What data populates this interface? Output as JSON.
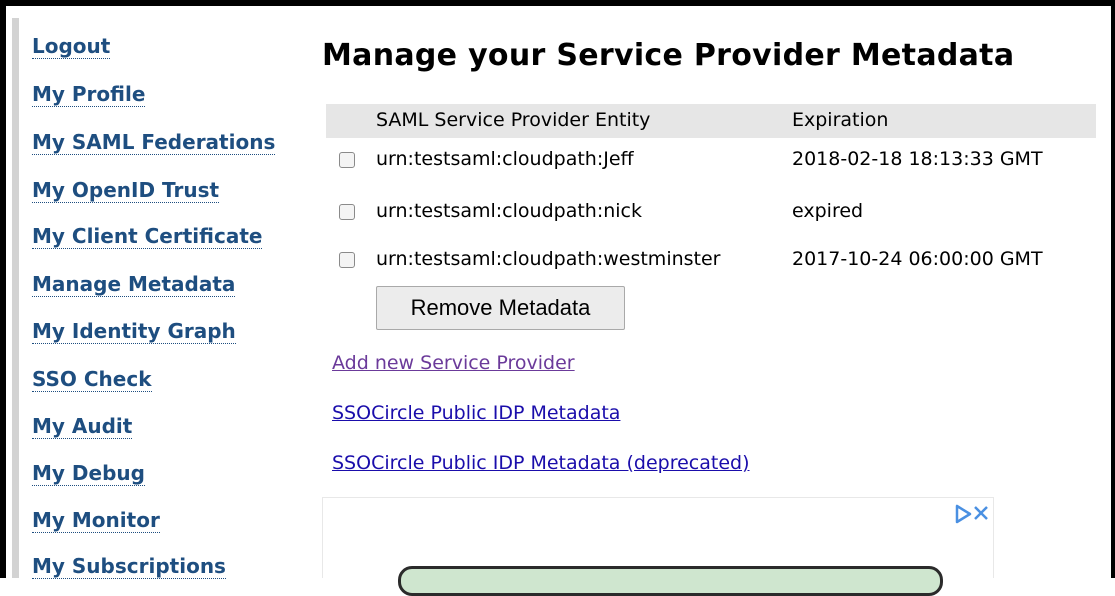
{
  "sidebar": {
    "items": [
      {
        "label": "Logout"
      },
      {
        "label": "My Profile"
      },
      {
        "label": "My SAML Federations"
      },
      {
        "label": "My OpenID Trust"
      },
      {
        "label": "My Client Certificate"
      },
      {
        "label": "Manage Metadata"
      },
      {
        "label": "My Identity Graph"
      },
      {
        "label": "SSO Check"
      },
      {
        "label": "My Audit"
      },
      {
        "label": "My Debug"
      },
      {
        "label": "My Monitor"
      },
      {
        "label": "My Subscriptions"
      }
    ]
  },
  "main": {
    "title": "Manage your Service Provider Metadata",
    "table": {
      "headers": [
        "SAML Service Provider Entity",
        "Expiration"
      ],
      "rows": [
        {
          "entity": "urn:testsaml:cloudpath:Jeff",
          "expiration": "2018-02-18 18:13:33 GMT",
          "checked": false
        },
        {
          "entity": "urn:testsaml:cloudpath:nick",
          "expiration": "expired",
          "checked": false
        },
        {
          "entity": "urn:testsaml:cloudpath:westminster",
          "expiration": "2017-10-24 06:00:00 GMT",
          "checked": false
        }
      ]
    },
    "remove_button": "Remove Metadata",
    "links": [
      {
        "label": "Add new Service Provider",
        "color": "#6b3a9a"
      },
      {
        "label": "SSOCircle Public IDP Metadata",
        "color": "#1a0dab"
      },
      {
        "label": "SSOCircle Public IDP Metadata (deprecated)",
        "color": "#1a0dab"
      }
    ]
  },
  "ad": {
    "icons": [
      "adchoices-play-icon",
      "close-icon"
    ],
    "accent": "#4a90e2"
  },
  "colors": {
    "nav_link": "#1e4e80",
    "header_bg": "#e6e6e6",
    "sidebar_bar": "#d3d3d3"
  }
}
